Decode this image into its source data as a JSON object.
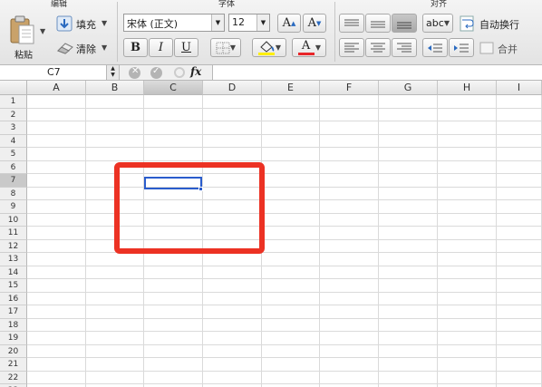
{
  "ribbon": {
    "groups": {
      "edit": "编辑",
      "font": "字体",
      "align": "对齐"
    },
    "paste_label": "粘贴",
    "fill_label": "填充",
    "clear_label": "清除",
    "font_name": "宋体 (正文)",
    "font_size": "12",
    "bold": "B",
    "italic": "I",
    "underline": "U",
    "grow_font": "A",
    "shrink_font": "A",
    "font_color_letter": "A",
    "abc_label": "abc",
    "wrap_label": "自动换行",
    "merge_label": "合并",
    "fill_color": "#ffef00",
    "font_color": "#e8262a"
  },
  "formula_bar": {
    "cell_ref": "C7",
    "fx": "fx",
    "formula": ""
  },
  "sheet": {
    "columns": [
      "A",
      "B",
      "C",
      "D",
      "E",
      "F",
      "G",
      "H",
      "I"
    ],
    "rows": [
      "1",
      "2",
      "3",
      "4",
      "5",
      "6",
      "7",
      "8",
      "9",
      "10",
      "11",
      "12",
      "13",
      "14",
      "15",
      "16",
      "17",
      "18",
      "19",
      "20",
      "21",
      "22",
      "23"
    ],
    "active_col": "C",
    "active_row": "7"
  },
  "annotation_color": "#ec3224"
}
